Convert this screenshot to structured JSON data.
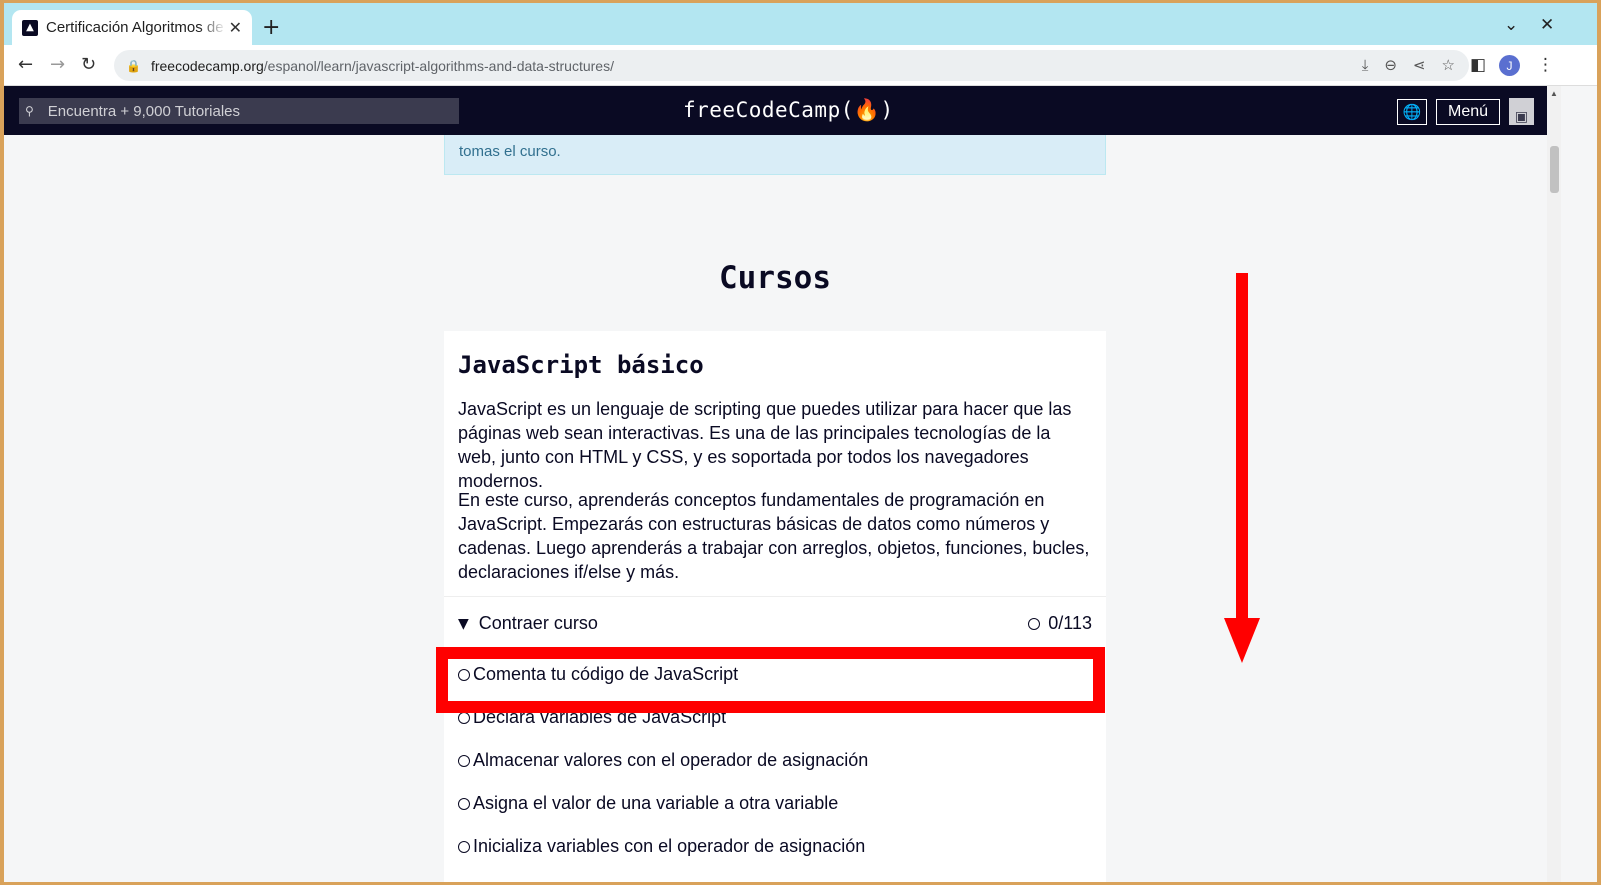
{
  "browser": {
    "tab_title": "Certificación Algoritmos de JavaScript y Estructuras de Datos",
    "tab_close": "✕",
    "new_tab": "+",
    "url_domain": "freecodecamp.org",
    "url_path": "/espanol/learn/javascript-algorithms-and-data-structures/",
    "profile_initial": "J",
    "icons": [
      "back-icon",
      "forward-icon",
      "reload-icon",
      "lock-icon",
      "install-icon",
      "zoom-icon",
      "share-icon",
      "bookmark-star-icon",
      "side-panel-icon",
      "kebab-menu-icon",
      "tab-list-chevron-icon",
      "window-close-icon"
    ]
  },
  "fcc_nav": {
    "search_placeholder": "Encuentra + 9,000 Tutoriales",
    "logo": "freeCodeCamp(🔥)",
    "menu_label": "Menú"
  },
  "alert_text": "tomas el curso.",
  "section_title": "Cursos",
  "course": {
    "title": "JavaScript básico",
    "intro_1": "JavaScript es un lenguaje de scripting que puedes utilizar para hacer que las páginas web sean interactivas. Es una de las principales tecnologías de la web, junto con HTML y CSS, y es soportada por todos los navegadores modernos.",
    "intro_2": "En este curso, aprenderás conceptos fundamentales de programación en JavaScript. Empezarás con estructuras básicas de datos como números y cadenas. Luego aprenderás a trabajar con arreglos, objetos, funciones, bucles, declaraciones if/else y más.",
    "collapse_label": "Contraer curso",
    "progress": "0/113",
    "lessons": [
      "Comenta tu código de JavaScript",
      "Declara variables de JavaScript",
      "Almacenar valores con el operador de asignación",
      "Asigna el valor de una variable a otra variable",
      "Inicializa variables con el operador de asignación"
    ]
  },
  "annotation_colors": {
    "highlight": "#ff0000",
    "arrow": "#ff0000"
  }
}
